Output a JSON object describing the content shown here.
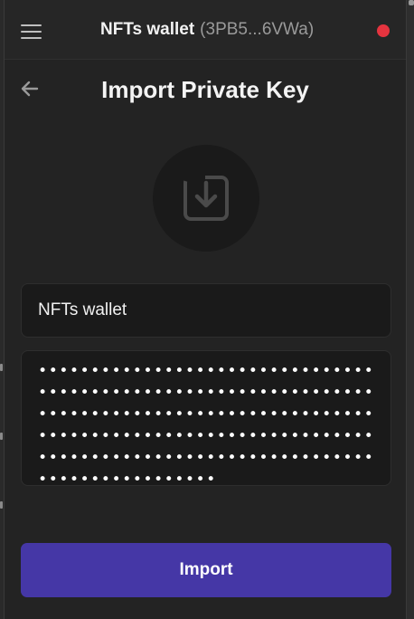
{
  "header": {
    "wallet_name": "NFTs wallet",
    "wallet_address": "(3PB5...6VWa)",
    "status_color": "#e5343f"
  },
  "page": {
    "title": "Import Private Key"
  },
  "form": {
    "name_value": "NFTs wallet",
    "key_masked": "•••••••••••••••••••••••••••••••••••••••••••••••••••••••••••••••••••••••••••••••••••••••••••••••••••••••••••••••••••••••••••••••••••••••••••••••••••••••••••••••••••••••••••••••••"
  },
  "actions": {
    "import_label": "Import"
  },
  "colors": {
    "accent": "#4537a6",
    "background": "#232323",
    "field": "#1a1a1a"
  },
  "icons": {
    "menu": "hamburger-menu-icon",
    "back": "arrow-left-icon",
    "hero": "import-download-icon"
  }
}
